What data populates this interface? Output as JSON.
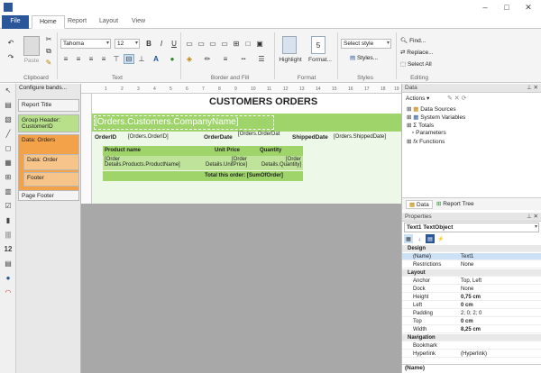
{
  "tabs": [
    "File",
    "Home",
    "Report",
    "Layout",
    "View"
  ],
  "ribbon": {
    "clipboard": {
      "paste": "Paste",
      "label": "Clipboard"
    },
    "text": {
      "font": "Tahoma",
      "size": "12",
      "bold": "B",
      "italic": "I",
      "underline": "U",
      "label": "Text"
    },
    "border": {
      "label": "Border and Fill"
    },
    "format": {
      "highlight": "Highlight",
      "format": "Format...",
      "label": "Format"
    },
    "styles": {
      "select": "Select style",
      "styles": "Styles...",
      "label": "Styles"
    },
    "editing": {
      "find": "Find...",
      "replace": "Replace...",
      "select_all": "Select All",
      "label": "Editing"
    }
  },
  "bands_pane": {
    "configure": "Configure bands...",
    "bands": [
      "Report Title",
      "Group Header: CustomerID",
      "Data: Orders",
      "Data: Order",
      "Footer",
      "Page Footer"
    ]
  },
  "report": {
    "title": "CUSTOMERS ORDERS",
    "company": "[Orders.Customers.CompanyName]",
    "orderid_label": "OrderID",
    "orderid_value": "[Orders.OrderID]",
    "orderdate_label": "OrderDate",
    "orderdate_value": "[Orders.OrderDat",
    "shipped_label": "ShippedDate",
    "shipped_value": "[Orders.ShippedDate]",
    "col_product": "Product name",
    "col_price": "Unit Price",
    "col_qty": "Quantity",
    "val_product_1": "[Order",
    "val_product_2": "Details.Products.ProductName]",
    "val_price_1": "[Order",
    "val_price_2": "Details.UnitPrice]",
    "val_qty_1": "[Order",
    "val_qty_2": "Details.Quantity]",
    "total": "Total this order: [SumOfOrder]"
  },
  "ruler": [
    "1",
    "2",
    "3",
    "4",
    "5",
    "6",
    "7",
    "8",
    "9",
    "10",
    "11",
    "12",
    "13",
    "14",
    "15",
    "16",
    "17",
    "18",
    "19"
  ],
  "data_pane": {
    "title": "Data",
    "actions": "Actions",
    "items": [
      "Data Sources",
      "System Variables",
      "Totals",
      "Parameters",
      "Functions"
    ],
    "tab_data": "Data",
    "tab_tree": "Report Tree"
  },
  "properties": {
    "title": "Properties",
    "object": "Text1  TextObject",
    "rows": [
      {
        "k": "Design",
        "v": "",
        "cat": true
      },
      {
        "k": "(Name)",
        "v": "Text1"
      },
      {
        "k": "Restrictions",
        "v": "None"
      },
      {
        "k": "Layout",
        "v": "",
        "cat": true
      },
      {
        "k": "Anchor",
        "v": "Top, Left"
      },
      {
        "k": "Dock",
        "v": "None"
      },
      {
        "k": "Height",
        "v": "0,75 cm",
        "bold": true
      },
      {
        "k": "Left",
        "v": "0 cm",
        "bold": true
      },
      {
        "k": "Padding",
        "v": "2; 0; 2; 0"
      },
      {
        "k": "Top",
        "v": "0 cm",
        "bold": true
      },
      {
        "k": "Width",
        "v": "8,25 cm",
        "bold": true
      },
      {
        "k": "Navigation",
        "v": "",
        "cat": true
      },
      {
        "k": "Bookmark",
        "v": ""
      },
      {
        "k": "Hyperlink",
        "v": "(Hyperlink)"
      }
    ],
    "footer": "(Name)"
  }
}
